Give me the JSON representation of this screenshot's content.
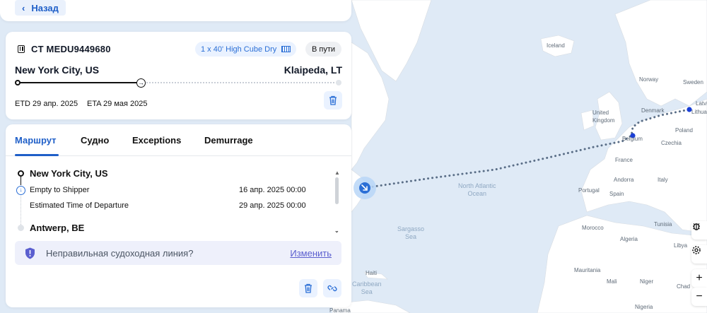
{
  "nav": {
    "back_label": "Назад"
  },
  "shipment": {
    "container_number": "CT MEDU9449680",
    "cargo": "1 x 40' High Cube Dry",
    "status": "В пути",
    "origin": "New York City, US",
    "destination": "Klaipeda, LT",
    "etd": "ETD 29 апр. 2025",
    "eta": "ETA 29 мая 2025",
    "progress_fraction": 0.39
  },
  "tabs": [
    {
      "label": "Маршрут",
      "active": true
    },
    {
      "label": "Судно",
      "active": false
    },
    {
      "label": "Exceptions",
      "active": false
    },
    {
      "label": "Demurrage",
      "active": false
    }
  ],
  "timeline": [
    {
      "type": "port",
      "name": "New York City, US"
    },
    {
      "type": "event",
      "label": "Empty to Shipper",
      "date": "16 апр. 2025 00:00"
    },
    {
      "type": "event",
      "label": "Estimated Time of Departure",
      "date": "29 апр. 2025 00:00"
    },
    {
      "type": "port",
      "name": "Antwerp, BE"
    }
  ],
  "warning": {
    "text": "Неправильная судоходная линия?",
    "link": "Изменить"
  },
  "map": {
    "labels": {
      "iceland": "Iceland",
      "norway": "Norway",
      "sweden": "Sweden",
      "uk": "United\nKingdom",
      "denmark": "Denmark",
      "latvia": "Latvia",
      "lithuania": "Lithuania",
      "belgium": "Belgium",
      "poland": "Poland",
      "czechia": "Czechia",
      "france": "France",
      "andorra": "Andorra",
      "portugal": "Portugal",
      "spain": "Spain",
      "italy": "Italy",
      "morocco": "Morocco",
      "tunisia": "Tunisia",
      "algeria": "Algeria",
      "libya": "Libya",
      "mauritania": "Mauritania",
      "mali": "Mali",
      "niger": "Niger",
      "chad": "Chad",
      "nigeria": "Nigeria",
      "haiti": "Haiti",
      "caribbean": "Caribbean\nSea",
      "panama": "Panama",
      "north_atlantic": "North Atlantic\nOcean",
      "sargasso": "Sargasso\nSea"
    },
    "controls": {
      "zoom_in": "+",
      "zoom_out": "−"
    },
    "colors": {
      "route": "#5a6e87",
      "land": "#ffffff",
      "water": "#dfeaf6",
      "accent": "#2b6fd6"
    }
  }
}
